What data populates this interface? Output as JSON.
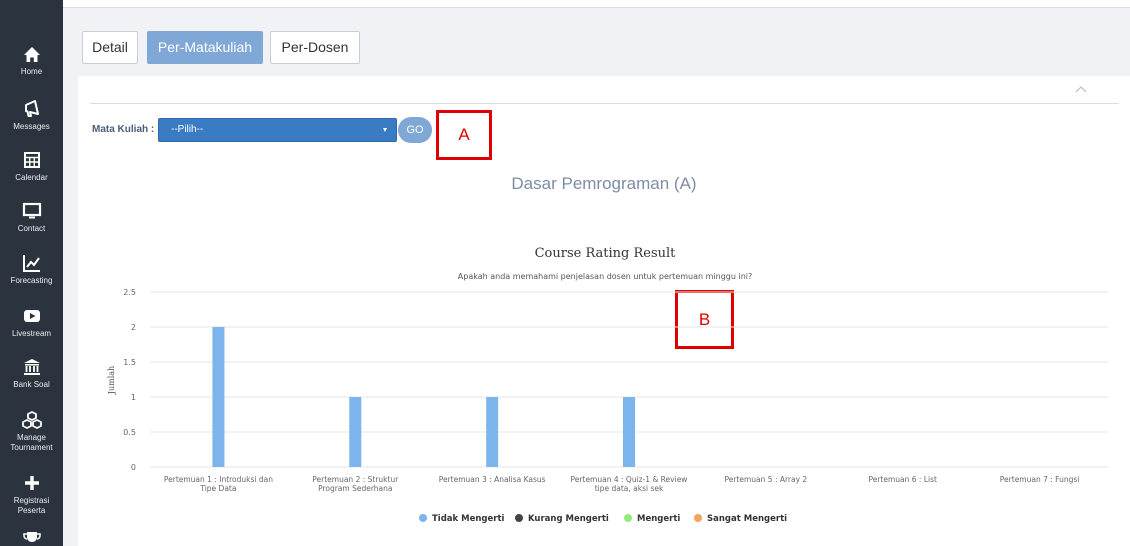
{
  "sidebar": {
    "items": [
      {
        "label": "Home",
        "icon": "home-icon"
      },
      {
        "label": "Messages",
        "icon": "megaphone-icon"
      },
      {
        "label": "Calendar",
        "icon": "calendar-icon"
      },
      {
        "label": "Contact",
        "icon": "monitor-icon"
      },
      {
        "label": "Forecasting",
        "icon": "trend-chart-icon"
      },
      {
        "label": "Livestream",
        "icon": "play-icon"
      },
      {
        "label": "Bank Soal",
        "icon": "bank-icon"
      },
      {
        "label": "Manage Tournament",
        "icon": "cubes-icon"
      },
      {
        "label": "Registrasi Peserta",
        "icon": "plus-icon"
      },
      {
        "label": "",
        "icon": "trophy-icon"
      }
    ]
  },
  "tabs": [
    {
      "label": "Detail"
    },
    {
      "label": "Per-Matakuliah"
    },
    {
      "label": "Per-Dosen"
    }
  ],
  "filter": {
    "label": "Mata Kuliah :",
    "selected": "--Pilih--",
    "go_label": "GO"
  },
  "annotations": {
    "a": "A",
    "b": "B"
  },
  "course_title": "Dasar Pemrograman (A)",
  "colors": {
    "sidebar_bg": "#2b333e",
    "accent": "#7fa8d6",
    "select_bg": "#3a7cc4",
    "annotation": "#e00000"
  },
  "chart_data": {
    "type": "bar",
    "title": "Course Rating Result",
    "subtitle": "Apakah anda memahami penjelasan dosen untuk pertemuan minggu ini?",
    "ylabel": "Jumlah",
    "xlabel": "",
    "ylim": [
      0,
      2.5
    ],
    "yticks": [
      "0",
      "0.5",
      "1",
      "1.5",
      "2",
      "2.5"
    ],
    "grid": true,
    "legend_position": "bottom",
    "categories": [
      [
        "Pertemuan 1 : Introduksi dan",
        "Tipe Data"
      ],
      [
        "Pertemuan 2 : Struktur",
        "Program Sederhana"
      ],
      [
        "Pertemuan 3 : Analisa Kasus"
      ],
      [
        "Pertemuan 4 : Quiz-1 & Review",
        "tipe data, aksi sek"
      ],
      [
        "Pertemuan 5 : Array 2"
      ],
      [
        "Pertemuan 6 : List"
      ],
      [
        "Pertemuan 7 : Fungsi"
      ]
    ],
    "series": [
      {
        "name": "Tidak Mengerti",
        "color": "#7cb5ec",
        "values": [
          2,
          1,
          1,
          1,
          0,
          0,
          0
        ]
      },
      {
        "name": "Kurang Mengerti",
        "color": "#434348",
        "values": [
          0,
          0,
          0,
          0,
          0,
          0,
          0
        ]
      },
      {
        "name": "Mengerti",
        "color": "#90ed7d",
        "values": [
          0,
          0,
          0,
          0,
          0,
          0,
          0
        ]
      },
      {
        "name": "Sangat Mengerti",
        "color": "#f7a35c",
        "values": [
          0,
          0,
          0,
          0,
          0,
          0,
          0
        ]
      }
    ]
  }
}
